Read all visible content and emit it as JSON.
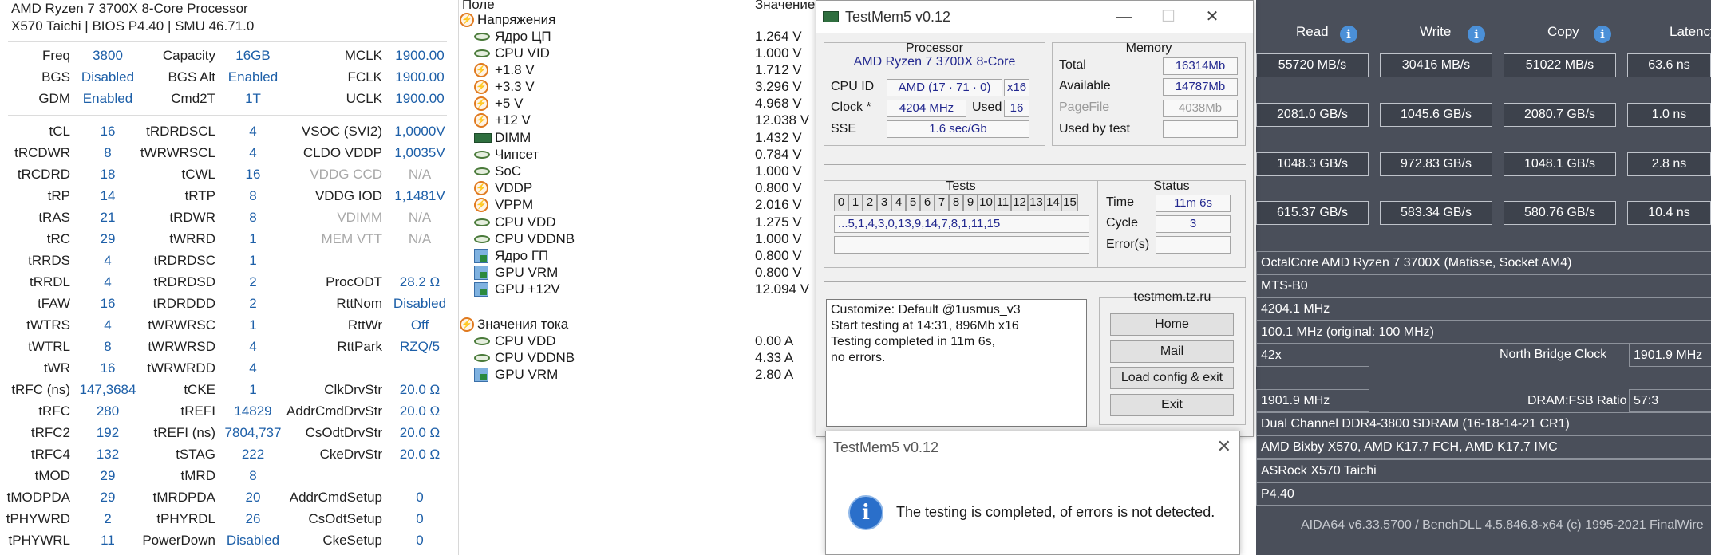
{
  "zen": {
    "cpu_name": "AMD Ryzen 7 3700X 8-Core Processor",
    "board_info": "X570 Taichi | BIOS P4.40 | SMU 46.71.0",
    "rows": [
      [
        "Freq",
        "3800",
        "Capacity",
        "16GB",
        "MCLK",
        "1900.00"
      ],
      [
        "BGS",
        "Disabled",
        "BGS Alt",
        "Enabled",
        "FCLK",
        "1900.00"
      ],
      [
        "GDM",
        "Enabled",
        "Cmd2T",
        "1T",
        "UCLK",
        "1900.00"
      ],
      [
        "tCL",
        "16",
        "tRDRDSCL",
        "4",
        "VSOC (SVI2)",
        "1,0000V"
      ],
      [
        "tRCDWR",
        "8",
        "tWRWRSCL",
        "4",
        "CLDO VDDP",
        "1,0035V"
      ],
      [
        "tRCDRD",
        "18",
        "tCWL",
        "16",
        "VDDG CCD",
        "N/A"
      ],
      [
        "tRP",
        "14",
        "tRTP",
        "8",
        "VDDG IOD",
        "1,1481V"
      ],
      [
        "tRAS",
        "21",
        "tRDWR",
        "8",
        "VDIMM",
        "N/A"
      ],
      [
        "tRC",
        "29",
        "tWRRD",
        "1",
        "MEM VTT",
        "N/A"
      ],
      [
        "tRRDS",
        "4",
        "tRDRDSC",
        "1",
        "",
        ""
      ],
      [
        "tRRDL",
        "4",
        "tRDRDSD",
        "2",
        "ProcODT",
        "28.2 Ω"
      ],
      [
        "tFAW",
        "16",
        "tRDRDDD",
        "2",
        "RttNom",
        "Disabled"
      ],
      [
        "tWTRS",
        "4",
        "tWRWRSC",
        "1",
        "RttWr",
        "Off"
      ],
      [
        "tWTRL",
        "8",
        "tWRWRSD",
        "4",
        "RttPark",
        "RZQ/5"
      ],
      [
        "tWR",
        "16",
        "tWRWRDD",
        "4",
        "",
        ""
      ],
      [
        "tRFC (ns)",
        "147,3684",
        "tCKE",
        "1",
        "ClkDrvStr",
        "20.0 Ω"
      ],
      [
        "tRFC",
        "280",
        "tREFI",
        "14829",
        "AddrCmdDrvStr",
        "20.0 Ω"
      ],
      [
        "tRFC2",
        "192",
        "tREFI (ns)",
        "7804,737",
        "CsOdtDrvStr",
        "20.0 Ω"
      ],
      [
        "tRFC4",
        "132",
        "tSTAG",
        "222",
        "CkeDrvStr",
        "20.0 Ω"
      ],
      [
        "tMOD",
        "29",
        "tMRD",
        "8",
        "",
        ""
      ],
      [
        "tMODPDA",
        "29",
        "tMRDPDA",
        "20",
        "AddrCmdSetup",
        "0"
      ],
      [
        "tPHYWRD",
        "2",
        "tPHYRDL",
        "26",
        "CsOdtSetup",
        "0"
      ],
      [
        "tPHYWRL",
        "11",
        "PowerDown",
        "Disabled",
        "CkeSetup",
        "0"
      ]
    ]
  },
  "hwinfo": {
    "col_field": "Поле",
    "col_value": "Значение",
    "rows": [
      {
        "name": "Напряжения",
        "value": "",
        "icon": "bolt",
        "group": true
      },
      {
        "name": "Ядро ЦП",
        "value": "1.264 V",
        "icon": "volt"
      },
      {
        "name": "CPU VID",
        "value": "1.000 V",
        "icon": "volt"
      },
      {
        "name": "+1.8 V",
        "value": "1.712 V",
        "icon": "bolt"
      },
      {
        "name": "+3.3 V",
        "value": "3.296 V",
        "icon": "bolt"
      },
      {
        "name": "+5 V",
        "value": "4.968 V",
        "icon": "bolt"
      },
      {
        "name": "+12 V",
        "value": "12.038 V",
        "icon": "bolt"
      },
      {
        "name": "DIMM",
        "value": "1.432 V",
        "icon": "chip"
      },
      {
        "name": "Чипсет",
        "value": "0.784 V",
        "icon": "volt"
      },
      {
        "name": "SoC",
        "value": "1.000 V",
        "icon": "volt"
      },
      {
        "name": "VDDP",
        "value": "0.800 V",
        "icon": "bolt"
      },
      {
        "name": "VPPM",
        "value": "2.016 V",
        "icon": "bolt"
      },
      {
        "name": "CPU VDD",
        "value": "1.275 V",
        "icon": "volt"
      },
      {
        "name": "CPU VDDNB",
        "value": "1.000 V",
        "icon": "volt"
      },
      {
        "name": "Ядро ГП",
        "value": "0.800 V",
        "icon": "gpu"
      },
      {
        "name": "GPU VRM",
        "value": "0.800 V",
        "icon": "gpu"
      },
      {
        "name": "GPU +12V",
        "value": "12.094 V",
        "icon": "gpu"
      },
      {
        "name": "Значения тока",
        "value": "",
        "icon": "bolt",
        "group": true
      },
      {
        "name": "CPU VDD",
        "value": "0.00 A",
        "icon": "volt"
      },
      {
        "name": "CPU VDDNB",
        "value": "4.33 A",
        "icon": "volt"
      },
      {
        "name": "GPU VRM",
        "value": "2.80 A",
        "icon": "gpu"
      }
    ]
  },
  "aida": {
    "headers": [
      "Read",
      "Write",
      "Copy",
      "Latency"
    ],
    "bench_rows": [
      [
        "55720 MB/s",
        "30416 MB/s",
        "51022 MB/s",
        "63.6 ns"
      ],
      [
        "2081.0 GB/s",
        "1045.6 GB/s",
        "2080.7 GB/s",
        "1.0 ns"
      ],
      [
        "1048.3 GB/s",
        "972.83 GB/s",
        "1048.1 GB/s",
        "2.8 ns"
      ],
      [
        "615.37 GB/s",
        "583.34 GB/s",
        "580.76 GB/s",
        "10.4 ns"
      ]
    ],
    "cpu_type": "OctalCore AMD Ryzen 7 3700X  (Matisse, Socket AM4)",
    "cpu_stepping": "MTS-B0",
    "cpu_clock": "4204.1 MHz",
    "cpu_fsb": "100.1 MHz  (original: 100 MHz)",
    "multiplier": "42x",
    "nb_clock_label": "North Bridge Clock",
    "nb_clock": "1901.9 MHz",
    "mem_bus": "1901.9 MHz",
    "dram_ratio_label": "DRAM:FSB Ratio",
    "dram_ratio": "57:3",
    "mem_type": "Dual Channel DDR4-3800 SDRAM  (16-18-14-21 CR1)",
    "chipset": "AMD Bixby X570, AMD K17.7 FCH, AMD K17.7 IMC",
    "motherboard": "ASRock X570 Taichi",
    "bios": "P4.40",
    "footer": "AIDA64 v6.33.5700 / BenchDLL 4.5.846.8-x64  (c) 1995-2021 FinalWire"
  },
  "testmem": {
    "title": "TestMem5 v0.12",
    "processor_title": "Processor",
    "processor_name": "AMD Ryzen 7 3700X 8-Core",
    "cpu_id_label": "CPU ID",
    "cpu_id": "AMD  (17 · 71 · 0)",
    "cpu_threads": "x16",
    "clock_label": "Clock *",
    "clock": "4204 MHz",
    "used_label": "Used",
    "used": "16",
    "sse_label": "SSE",
    "sse": "1.6 sec/Gb",
    "memory_title": "Memory",
    "total_label": "Total",
    "total": "16314Mb",
    "available_label": "Available",
    "available": "14787Mb",
    "pagefile_label": "PageFile",
    "pagefile": "4038Mb",
    "usedbytest_label": "Used by test",
    "usedbytest": "",
    "tests_title": "Tests",
    "test_numbers": [
      "0",
      "1",
      "2",
      "3",
      "4",
      "5",
      "6",
      "7",
      "8",
      "9",
      "10",
      "11",
      "12",
      "13",
      "14",
      "15"
    ],
    "test_sequence": "...5,1,4,3,0,13,9,14,7,8,1,11,15",
    "status_title": "Status",
    "time_label": "Time",
    "time": "11m 6s",
    "cycle_label": "Cycle",
    "cycle": "3",
    "errors_label": "Error(s)",
    "errors": "",
    "log": "Customize: Default @1usmus_v3\nStart testing at 14:31, 896Mb x16\nTesting completed in 11m 6s,\nno errors.",
    "site": "testmem.tz.ru",
    "buttons": [
      "Home",
      "Mail",
      "Load config & exit",
      "Exit"
    ]
  },
  "dialog": {
    "title": "TestMem5 v0.12",
    "message": "The testing is completed, of errors is not detected."
  }
}
